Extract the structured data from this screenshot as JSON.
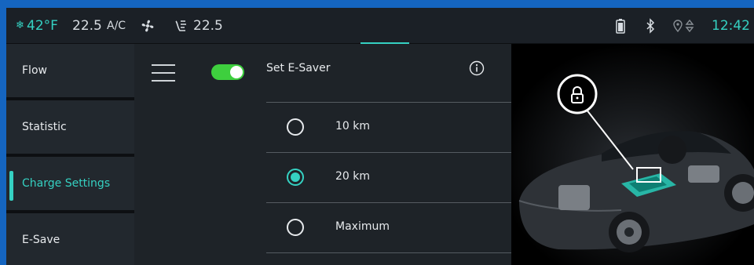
{
  "status": {
    "snow_icon": "❄",
    "outside_temp": "42°F",
    "temp_left": "22.5",
    "ac_label": "A/C",
    "fan_icon": "fan-icon",
    "seat_icon": "seat-airflow-icon",
    "temp_right": "22.5",
    "time": "12:42"
  },
  "sidebar": {
    "items": [
      {
        "label": "Flow"
      },
      {
        "label": "Statistic"
      },
      {
        "label": "Charge Settings"
      },
      {
        "label": "E-Save"
      }
    ]
  },
  "main": {
    "toggle_on": true,
    "title": "Set E-Saver",
    "options": [
      {
        "label": "10 km",
        "selected": false
      },
      {
        "label": "20 km",
        "selected": true
      },
      {
        "label": "Maximum",
        "selected": false
      }
    ]
  },
  "colors": {
    "accent": "#35d1c2",
    "toggle": "#3ecf3e",
    "frame": "#1565c0"
  }
}
